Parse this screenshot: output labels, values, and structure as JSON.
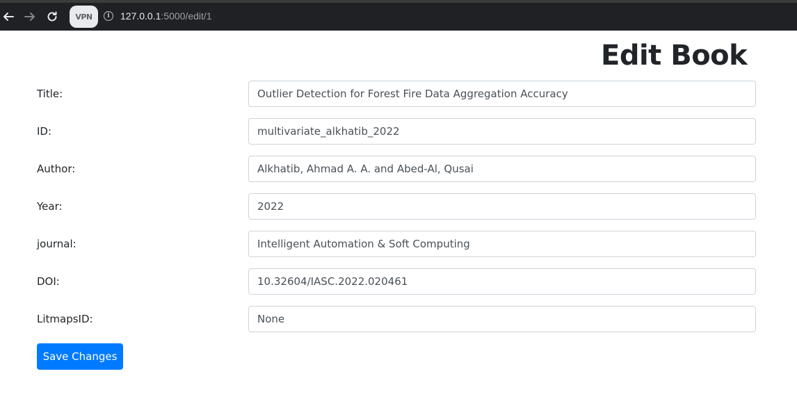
{
  "browser": {
    "vpn_label": "VPN",
    "url_host": "127.0.0.1",
    "url_path": ":5000/edit/1",
    "info_glyph": "i"
  },
  "page": {
    "title": "Edit Book"
  },
  "form": {
    "fields": [
      {
        "label": "Title:",
        "value": "Outlier Detection for Forest Fire Data Aggregation Accuracy"
      },
      {
        "label": "ID:",
        "value": "multivariate_alkhatib_2022"
      },
      {
        "label": "Author:",
        "value": "Alkhatib, Ahmad A. A. and Abed-Al, Qusai"
      },
      {
        "label": "Year:",
        "value": "2022"
      },
      {
        "label": "journal:",
        "value": "Intelligent Automation & Soft Computing"
      },
      {
        "label": "DOI:",
        "value": "10.32604/IASC.2022.020461"
      },
      {
        "label": "LitmapsID:",
        "value": "None"
      }
    ],
    "submit_label": "Save Changes"
  },
  "colors": {
    "primary": "#007bff",
    "chrome_bg": "#202124"
  }
}
